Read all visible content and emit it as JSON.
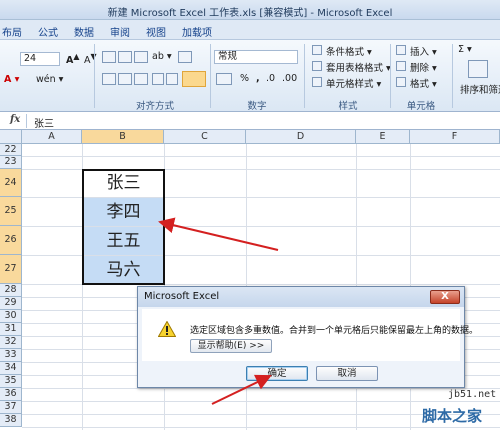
{
  "window": {
    "title": "新建 Microsoft Excel 工作表.xls  [兼容模式] - Microsoft Excel"
  },
  "menu": {
    "tabs": [
      "布局",
      "公式",
      "数据",
      "审阅",
      "视图",
      "加载项"
    ]
  },
  "ribbon": {
    "font_size": "24",
    "number_format": "常规",
    "groups": {
      "alignment": "对齐方式",
      "number": "数字",
      "styles": "样式",
      "cells": "单元格"
    },
    "buttons": {
      "conditional_format": "条件格式",
      "table_format": "套用表格格式",
      "cell_styles": "单元格样式",
      "insert": "插入",
      "delete": "删除",
      "format": "格式",
      "sort_filter": "排序和筛选"
    },
    "percent": "%",
    "comma": ","
  },
  "formula_bar": {
    "fx": "fx",
    "value": "张三"
  },
  "grid": {
    "columns": [
      "A",
      "B",
      "C",
      "D",
      "E",
      "F"
    ],
    "rows": [
      "22",
      "23",
      "24",
      "25",
      "26",
      "27",
      "28",
      "29",
      "30",
      "31",
      "32",
      "33",
      "34",
      "35",
      "36",
      "37",
      "38"
    ],
    "cells": {
      "B24": "张三",
      "B25": "李四",
      "B26": "王五",
      "B27": "马六"
    }
  },
  "dialog": {
    "title": "Microsoft Excel",
    "message": "选定区域包含多重数值。合并到一个单元格后只能保留最左上角的数据。",
    "help_label": "显示帮助(E) >>",
    "ok_label": "确定",
    "cancel_label": "取消",
    "close_label": "X"
  },
  "watermark": {
    "site": "jb51.net",
    "brand": "脚本之家"
  }
}
